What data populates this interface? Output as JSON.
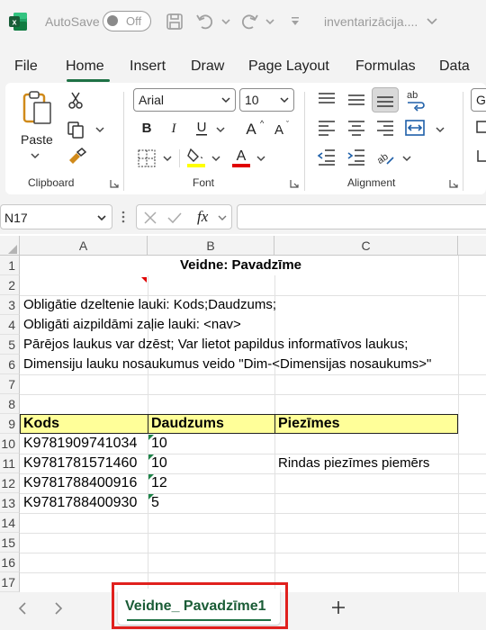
{
  "titlebar": {
    "autosave_label": "AutoSave",
    "toggle_state": "Off",
    "doc_title": "inventarizācija...."
  },
  "tabs": [
    "File",
    "Home",
    "Insert",
    "Draw",
    "Page Layout",
    "Formulas",
    "Data"
  ],
  "active_tab": "Home",
  "ribbon": {
    "clipboard": {
      "label": "Clipboard",
      "paste_label": "Paste"
    },
    "font": {
      "label": "Font",
      "font_name": "Arial",
      "font_size": "10"
    },
    "alignment": {
      "label": "Alignment"
    },
    "partial_style_text": "Ge"
  },
  "formula_bar": {
    "name_box": "N17",
    "fx_label": "fx",
    "formula": ""
  },
  "grid": {
    "columns": [
      "A",
      "B",
      "C"
    ],
    "rows": [
      "1",
      "2",
      "3",
      "4",
      "5",
      "6",
      "7",
      "8",
      "9",
      "10",
      "11",
      "12",
      "13",
      "14",
      "15",
      "16",
      "17"
    ],
    "title": "Veidne: Pavadzīme",
    "notes": [
      "Obligātie dzeltenie lauki: Kods;Daudzums;",
      "Obligāti aizpildāmi zaļie lauki: <nav>",
      "Pārējos laukus var dzēst; Var lietot papildus informatīvos laukus;",
      "Dimensiju lauku nosaukumus veido \"Dim-<Dimensijas nosaukums>\""
    ],
    "headers": [
      "Kods",
      "Daudzums",
      "Piezīmes"
    ],
    "data_rows": [
      {
        "kods": "K9781909741034",
        "daudzums": "10",
        "piezimes": ""
      },
      {
        "kods": "K9781781571460",
        "daudzums": "10",
        "piezimes": "Rindas piezīmes piemērs"
      },
      {
        "kods": "K9781788400916",
        "daudzums": "12",
        "piezimes": ""
      },
      {
        "kods": "K9781788400930",
        "daudzums": "5",
        "piezimes": ""
      }
    ]
  },
  "sheets": {
    "active": "Veidne_ Pavadzīme1"
  },
  "colors": {
    "accent": "#1e7145",
    "header_fill": "#ffff99",
    "highlight": "#e0201d"
  }
}
